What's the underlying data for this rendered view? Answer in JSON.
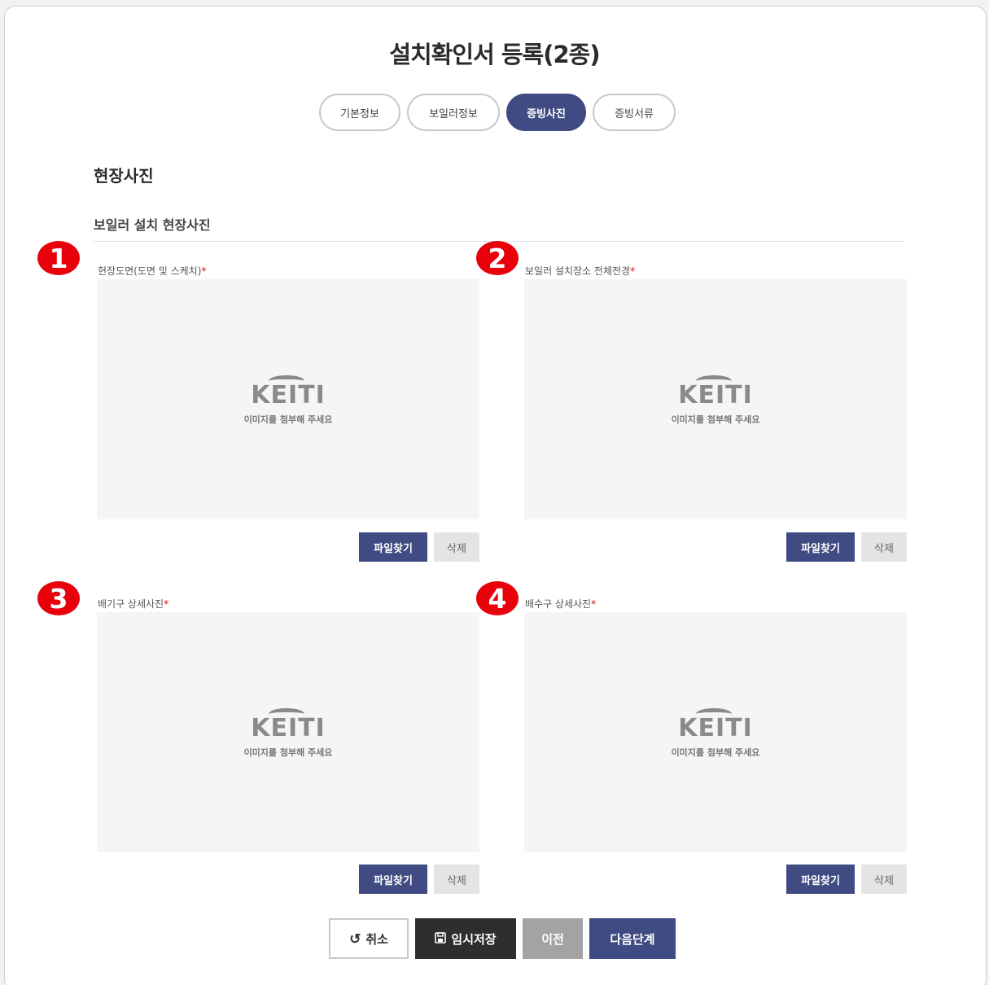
{
  "page": {
    "title": "설치확인서 등록(2종)"
  },
  "steps": [
    {
      "label": "기본정보",
      "active": false
    },
    {
      "label": "보일러정보",
      "active": false
    },
    {
      "label": "증빙사진",
      "active": true
    },
    {
      "label": "증빙서류",
      "active": false
    }
  ],
  "section": {
    "title": "현장사진",
    "subtitle": "보일러 설치 현장사진"
  },
  "uploads": [
    {
      "badge": "1",
      "label": "현장도면(도면 및 스케치)",
      "required": "*",
      "logo": "KEITI",
      "hint": "이미지를 첨부해 주세요",
      "find_label": "파일찾기",
      "delete_label": "삭제"
    },
    {
      "badge": "2",
      "label": "보일러 설치장소 전체전경",
      "required": "*",
      "logo": "KEITI",
      "hint": "이미지를 첨부해 주세요",
      "find_label": "파일찾기",
      "delete_label": "삭제"
    },
    {
      "badge": "3",
      "label": "배기구 상세사진",
      "required": "*",
      "logo": "KEITI",
      "hint": "이미지를 첨부해 주세요",
      "find_label": "파일찾기",
      "delete_label": "삭제"
    },
    {
      "badge": "4",
      "label": "배수구 상세사진",
      "required": "*",
      "logo": "KEITI",
      "hint": "이미지를 첨부해 주세요",
      "find_label": "파일찾기",
      "delete_label": "삭제"
    }
  ],
  "actions": {
    "cancel": "취소",
    "temp_save": "임시저장",
    "prev": "이전",
    "next": "다음단계"
  },
  "colors": {
    "primary": "#3f4b82",
    "badge": "#e8000b",
    "dark": "#2e2e2e",
    "muted": "#a3a3a3"
  }
}
